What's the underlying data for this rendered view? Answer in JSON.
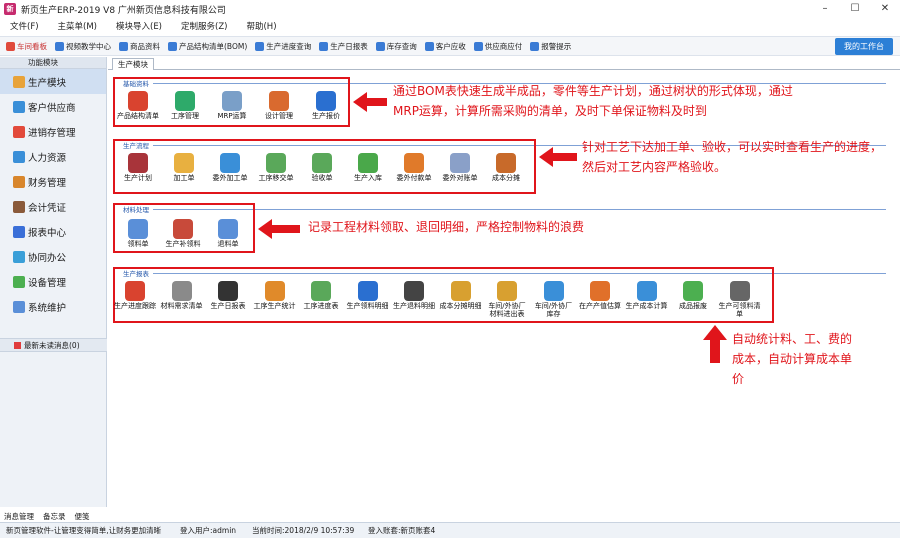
{
  "window": {
    "title": "新页生产ERP-2019 V8 广州新页信息科技有限公司",
    "icon": "app-logo-icon"
  },
  "menu": [
    "文件(F)",
    "主菜单(M)",
    "模块导入(E)",
    "定制服务(Z)",
    "帮助(H)"
  ],
  "toolbar": {
    "items": [
      {
        "label": "车间看板",
        "icon": "board-icon",
        "color": "#e04a3c"
      },
      {
        "label": "视频教学中心",
        "icon": "video-icon",
        "color": "#3a7bd5"
      },
      {
        "label": "商品资料",
        "icon": "goods-icon",
        "color": "#3a7bd5"
      },
      {
        "label": "产品结构清单(BOM)",
        "icon": "bom-icon",
        "color": "#3a7bd5"
      },
      {
        "label": "生产进度查询",
        "icon": "progress-icon",
        "color": "#3a7bd5"
      },
      {
        "label": "生产日报表",
        "icon": "daily-report-icon",
        "color": "#3a7bd5"
      },
      {
        "label": "库存查询",
        "icon": "stock-icon",
        "color": "#3a7bd5"
      },
      {
        "label": "客户应收",
        "icon": "receivable-icon",
        "color": "#3a7bd5"
      },
      {
        "label": "供应商应付",
        "icon": "payable-icon",
        "color": "#3a7bd5"
      },
      {
        "label": "报警提示",
        "icon": "alarm-icon",
        "color": "#3a7bd5"
      }
    ],
    "workbench": "我的工作台"
  },
  "sidebar": {
    "header": "功能模块",
    "items": [
      {
        "label": "生产模块",
        "icon": "folder-icon",
        "color": "#e8a33a",
        "active": true
      },
      {
        "label": "客户供应商",
        "icon": "people-icon",
        "color": "#3a8fd8"
      },
      {
        "label": "进销存管理",
        "icon": "chart-icon",
        "color": "#e24a3b"
      },
      {
        "label": "人力资源",
        "icon": "user-icon",
        "color": "#3a8fd8"
      },
      {
        "label": "财务管理",
        "icon": "finance-icon",
        "color": "#d8862c"
      },
      {
        "label": "会计凭证",
        "icon": "voucher-icon",
        "color": "#8a5a3a"
      },
      {
        "label": "报表中心",
        "icon": "report-icon",
        "color": "#3a6fd8"
      },
      {
        "label": "协同办公",
        "icon": "collab-icon",
        "color": "#3a9fd8"
      },
      {
        "label": "设备管理",
        "icon": "device-icon",
        "color": "#4caf50"
      },
      {
        "label": "系统维护",
        "icon": "gear-icon",
        "color": "#5a8fd8"
      }
    ],
    "messages": "最新未读消息(0)",
    "bottom": [
      "消息管理",
      "备忘录",
      "便笺"
    ]
  },
  "main": {
    "tab": "生产模块",
    "groups": [
      {
        "title": "基础资料",
        "items": [
          {
            "label": "产品结构清单",
            "icon": "pie-icon",
            "color": "#d9432f"
          },
          {
            "label": "工序管理",
            "icon": "circle-icon",
            "color": "#2eaa6a"
          },
          {
            "label": "MRP运算",
            "icon": "pencil-icon",
            "color": "#7a9fc8"
          },
          {
            "label": "设计管理",
            "icon": "bars-icon",
            "color": "#d96a2f"
          },
          {
            "label": "生产报价",
            "icon": "p-icon",
            "color": "#2a6fd0"
          }
        ]
      },
      {
        "title": "生产流程",
        "items": [
          {
            "label": "生产计划",
            "icon": "book-icon",
            "color": "#a8343a"
          },
          {
            "label": "加工单",
            "icon": "folder-doc-icon",
            "color": "#e8b040"
          },
          {
            "label": "委外加工单",
            "icon": "doc-icon",
            "color": "#3a8fd8"
          },
          {
            "label": "工序移交单",
            "icon": "check-doc-icon",
            "color": "#5aa85a"
          },
          {
            "label": "验收单",
            "icon": "check-doc-icon",
            "color": "#5aa85a"
          },
          {
            "label": "生产入库",
            "icon": "arrow-left-icon",
            "color": "#4aa84a"
          },
          {
            "label": "委外付款单",
            "icon": "rss-icon",
            "color": "#e07a2a"
          },
          {
            "label": "委外对账单",
            "icon": "p-icon",
            "color": "#8aa0c8"
          },
          {
            "label": "成本分摊",
            "icon": "donut-icon",
            "color": "#c86a2a"
          }
        ]
      },
      {
        "title": "材料处理",
        "items": [
          {
            "label": "领料单",
            "icon": "arrow-right-icon",
            "color": "#5a8fd8"
          },
          {
            "label": "生产补领料",
            "icon": "form-icon",
            "color": "#c84a3a"
          },
          {
            "label": "退料单",
            "icon": "arrow-left-icon",
            "color": "#5a8fd8"
          }
        ]
      },
      {
        "title": "生产报表",
        "items": [
          {
            "label": "生产进度跟踪",
            "icon": "clock-icon",
            "color": "#d9432f"
          },
          {
            "label": "材料需求清单",
            "icon": "notepad-icon",
            "color": "#8a8a8a"
          },
          {
            "label": "生产日报表",
            "icon": "calendar-icon",
            "color": "#333333"
          },
          {
            "label": "工序生产统计",
            "icon": "person-icon",
            "color": "#e08a2a"
          },
          {
            "label": "工序进度表",
            "icon": "check-doc-icon",
            "color": "#5aa85a"
          },
          {
            "label": "生产领料明细",
            "icon": "book-stack-icon",
            "color": "#2a6fd0"
          },
          {
            "label": "生产退料明细",
            "icon": "book-dark-icon",
            "color": "#444444"
          },
          {
            "label": "成本分摊明细",
            "icon": "money-icon",
            "color": "#d8a030"
          },
          {
            "label": "车间/外协厂材料进出表",
            "icon": "money-icon",
            "color": "#d8a030"
          },
          {
            "label": "车间/外协厂库存",
            "icon": "bar-chart-icon",
            "color": "#3a8fd8"
          },
          {
            "label": "在产产值估算",
            "icon": "calendar-color-icon",
            "color": "#e0702a"
          },
          {
            "label": "生产成本计算",
            "icon": "bar-chart-icon",
            "color": "#3a8fd8"
          },
          {
            "label": "成品报废",
            "icon": "recycle-icon",
            "color": "#4caf50"
          },
          {
            "label": "生产可领料清单",
            "icon": "docs-icon",
            "color": "#666666"
          }
        ]
      }
    ],
    "notes": {
      "basic": [
        "通过BOM表快速生成半成品，零件等生产计划，通过树状的形式体现，通过",
        "MRP运算，计算所需采购的清单，及时下单保证物料及时到"
      ],
      "flow": [
        "针对工艺下达加工单、验收，可以实时查看生产的进度，",
        "然后对工艺内容严格验收。"
      ],
      "material": "记录工程材料领取、退回明细，严格控制物料的浪费",
      "report": [
        "自动统计料、工、费的",
        "成本，自动计算成本单",
        "价"
      ]
    }
  },
  "status": {
    "slogan": "新页管理软件-让管理变得简单,让财务更加清晰",
    "user": "登入用户:admin",
    "time": "当前时间:2018/2/9 10:57:39",
    "account": "登入账套:新页账套4"
  },
  "colors": {
    "accent": "#2c7fd6",
    "highlight": "#e0151b"
  }
}
